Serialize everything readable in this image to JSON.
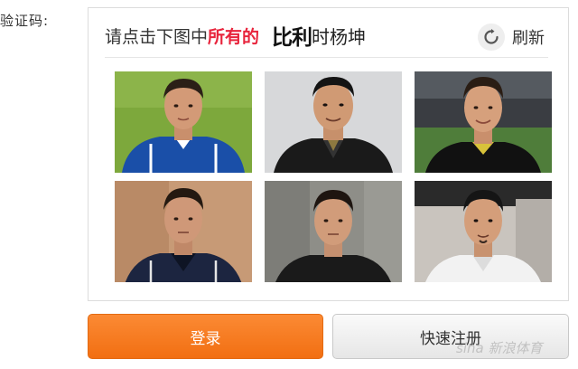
{
  "form": {
    "captcha_label": "验证码:"
  },
  "captcha": {
    "instruction_prefix": "请点击下图中",
    "instruction_highlight": "所有的",
    "target_name_part1": "比利",
    "target_name_part2": "时杨坤",
    "refresh_label": "刷新",
    "refresh_icon": "refresh-icon",
    "highlight_color": "#e8243c"
  },
  "tiles": [
    {
      "id": "tile-1",
      "subject": "hazard",
      "bg": "field-green",
      "shirt": "#1a4fa8"
    },
    {
      "id": "tile-2",
      "subject": "yang-kun",
      "bg": "studio-grey",
      "shirt": "#1a1a1a"
    },
    {
      "id": "tile-3",
      "subject": "hazard",
      "bg": "stadium",
      "shirt": "#111111"
    },
    {
      "id": "tile-4",
      "subject": "hazard",
      "bg": "warm-indoor",
      "shirt": "#1c2540"
    },
    {
      "id": "tile-5",
      "subject": "hazard",
      "bg": "stone-wall",
      "shirt": "#1a1a1a"
    },
    {
      "id": "tile-6",
      "subject": "yang-kun",
      "bg": "car-interior",
      "shirt": "#f2f2f2"
    }
  ],
  "buttons": {
    "login_label": "登录",
    "register_label": "快速注册",
    "login_color": "#f57a1f"
  },
  "watermark": "sina 新浪体育"
}
